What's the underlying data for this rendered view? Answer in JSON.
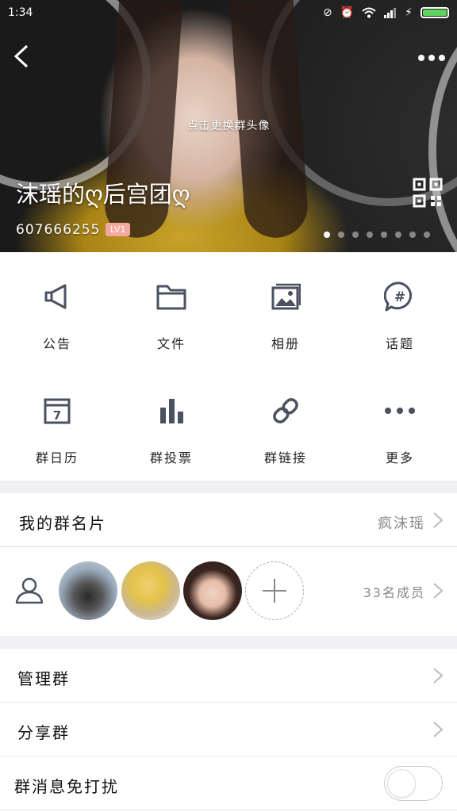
{
  "status_bar": {
    "time": "1:34"
  },
  "header": {
    "change_avatar_hint": "点击更换群头像",
    "group_name": "沫瑶的ღ后宫团ღ",
    "group_id": "607666255",
    "level": "LV1",
    "carousel_total": 8,
    "carousel_active": 0
  },
  "features": [
    {
      "label": "公告",
      "icon": "megaphone-icon"
    },
    {
      "label": "文件",
      "icon": "folder-icon"
    },
    {
      "label": "相册",
      "icon": "photo-album-icon"
    },
    {
      "label": "话题",
      "icon": "hashtag-bubble-icon"
    },
    {
      "label": "群日历",
      "icon": "calendar-icon"
    },
    {
      "label": "群投票",
      "icon": "bar-chart-icon"
    },
    {
      "label": "群链接",
      "icon": "link-icon"
    },
    {
      "label": "更多",
      "icon": "more-dots-icon"
    }
  ],
  "my_card": {
    "label": "我的群名片",
    "value": "疯沫瑶"
  },
  "members": {
    "count_label": "33名成员"
  },
  "settings": {
    "manage_label": "管理群",
    "share_label": "分享群",
    "mute_label": "群消息免打扰",
    "mute_enabled": false
  },
  "colors": {
    "icon": "#4a5160",
    "badge": "#f4a8a0",
    "battery": "#5ed35e"
  }
}
